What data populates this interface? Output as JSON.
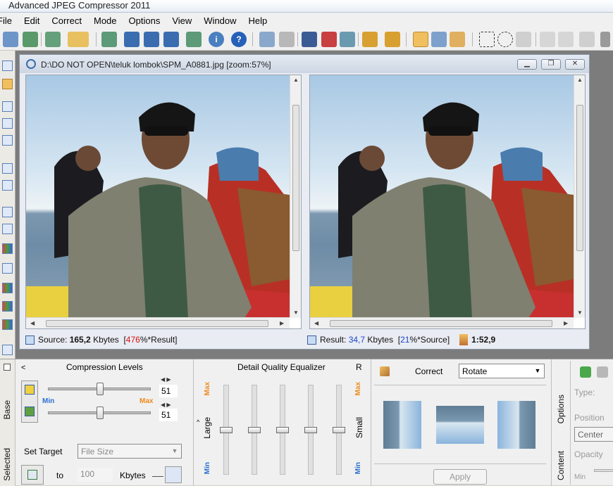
{
  "app": {
    "title": "Advanced JPEG Compressor 2011"
  },
  "menu": [
    "File",
    "Edit",
    "Correct",
    "Mode",
    "Options",
    "View",
    "Window",
    "Help"
  ],
  "toolbar_icons": [
    "open-icon",
    "batch-icon",
    "convert-icon",
    "folder-icon",
    "export-icon",
    "save-icon",
    "save-as-icon",
    "save-all-icon",
    "import-icon",
    "info-icon",
    "help-icon",
    "tile-icon",
    "cascade-icon",
    "crop-icon",
    "resize-icon",
    "preview-eye-icon",
    "edit-icon",
    "properties-icon",
    "hand-icon",
    "zoom-in-icon",
    "zoom-out-icon",
    "rect-select-icon",
    "ellipse-select-icon",
    "lasso-icon",
    "clear-select-icon",
    "invert-select-icon",
    "settings-icon"
  ],
  "document": {
    "title": "D:\\DO NOT OPEN\\teluk lombok\\SPM_A0881.jpg  [zoom:57%]",
    "source_label": "Source:",
    "source_size": "165,2",
    "source_unit": "Kbytes",
    "source_pct_open": "[",
    "source_pct": "476",
    "source_pct_tail": "%*Result]",
    "result_label": "Result:",
    "result_size": "34,7",
    "result_unit": "Kbytes",
    "result_pct_open": "[",
    "result_pct": "21",
    "result_pct_tail": "%*Source]",
    "ratio": "1:52,9"
  },
  "compression": {
    "tab_base": "Base",
    "tab_selected": "Selected",
    "back": "<",
    "title": "Compression Levels",
    "min": "Min",
    "max": "Max",
    "level1": "51",
    "level2": "51",
    "level1_fraction": 0.51,
    "level2_fraction": 0.51,
    "set_target": "Set Target",
    "target_mode": "File Size",
    "to": "to",
    "target_value": "100",
    "target_unit": "Kbytes"
  },
  "equalizer": {
    "title": "Detail Quality Equalizer",
    "r": "R",
    "max": "Max",
    "min": "Min",
    "large": "Large",
    "small": "Small",
    "band_levels": [
      0.5,
      0.5,
      0.5,
      0.5,
      0.5
    ]
  },
  "correct": {
    "label": "Correct",
    "mode": "Rotate",
    "apply": "Apply"
  },
  "watermark": {
    "type": "Type:",
    "position": "Position",
    "position_value": "Center",
    "opacity": "Opacity",
    "min": "Min",
    "tab_options": "Options",
    "tab_content": "Content"
  },
  "colors": {
    "accent_red": "#d81010",
    "accent_blue": "#1a46c8",
    "accent_orange": "#ef8a1a",
    "link_blue": "#2a6fd0"
  }
}
